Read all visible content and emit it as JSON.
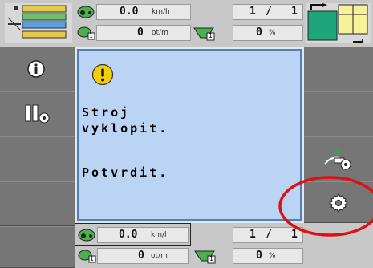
{
  "top": {
    "speed_value": "0.0",
    "speed_unit": "km/h",
    "rpm_value": "0",
    "rpm_unit": "ot/m",
    "page_current": "1",
    "page_sep": "/",
    "page_total": "1",
    "percent_value": "0",
    "percent_unit": "%",
    "rpm_badge": "1",
    "flow_badge": "1"
  },
  "dialog": {
    "line1": "Stroj",
    "line2": "vyklopit.",
    "line3": "Potvrdit."
  },
  "bottom": {
    "speed_value": "0.0",
    "speed_unit": "km/h",
    "rpm_value": "0",
    "rpm_unit": "ot/m",
    "page_current": "1",
    "page_sep": "/",
    "page_total": "1",
    "percent_value": "0",
    "percent_unit": "%",
    "rpm_badge": "1",
    "flow_badge": "1"
  },
  "colors": {
    "dialog_bg": "#bcd4f4",
    "warning_yellow": "#f2d000",
    "highlight_red": "#e01010",
    "panel_gray": "#767676"
  },
  "icons": {
    "left": [
      "info-icon",
      "machine-settings-icon"
    ],
    "right": [
      "implement-settings-icon",
      "gear-icon"
    ],
    "dialog": "warning-icon"
  }
}
